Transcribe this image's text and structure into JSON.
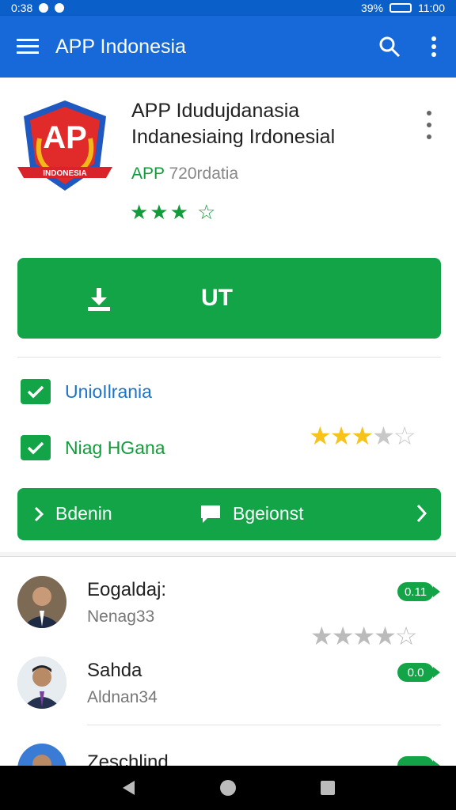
{
  "status": {
    "time_left": "0:38",
    "time_right": "11:00",
    "battery": "39%"
  },
  "appbar": {
    "title": "APP Indonesia",
    "menu_icon": "hamburger-icon",
    "search_icon": "search-icon",
    "more_icon": "more-vert-icon"
  },
  "app": {
    "logo_text": "AP",
    "logo_ribbon": "INDONESIA",
    "name_line1": "APP Idudujdanasia",
    "name_line2": "Indanesiaing Irdonesial",
    "dev_brand": "APP",
    "dev_meta": "720rdatia",
    "stars_top": "★★★ ☆",
    "install_label": "UT"
  },
  "permissions": [
    {
      "label": "UnioIlrania",
      "color": "#1b74c9"
    },
    {
      "label": "Niag HGana",
      "color": "#129b3a"
    }
  ],
  "rating_mid": {
    "filled": "★★★",
    "partial": "★",
    "empty": "☆",
    "value": 3
  },
  "actions": {
    "left_label": "Bdenin",
    "right_label": "Bgeionst"
  },
  "reviews": [
    {
      "name": "Eogaldaj:",
      "sub": "Nenag33",
      "badge": "0.11"
    },
    {
      "name": "Sahda",
      "sub": "Aldnan34",
      "badge": "0.0"
    },
    {
      "name": "Zeschlind",
      "sub": "",
      "badge": ""
    }
  ],
  "review_rating": {
    "stars": "★★★★☆",
    "value": 4
  },
  "colors": {
    "primary": "#1768d8",
    "accent": "#12a446",
    "star_gold": "#f7c21a"
  }
}
